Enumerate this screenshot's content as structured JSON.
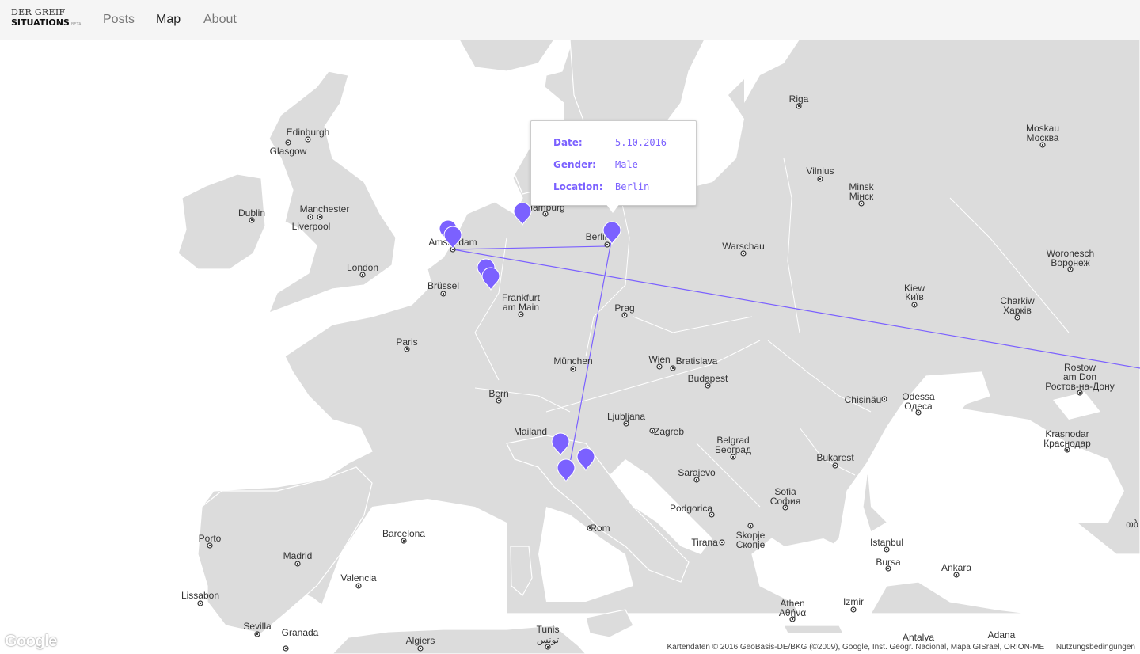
{
  "nav": {
    "logo_top": "DER GREIF",
    "logo_bottom": "SITUATIONS",
    "logo_beta": "BETA",
    "links": [
      "Posts",
      "Map",
      "About"
    ],
    "active": "Map"
  },
  "map": {
    "accent_color": "#7B61FF",
    "land_color": "#dcdcdc",
    "water_color": "#ffffff",
    "cities": [
      "Riga",
      "Edinburgh",
      "Glasgow",
      "Moskau",
      "Москва",
      "Dublin",
      "Manchester",
      "Liverpool",
      "Vilnius",
      "Minsk",
      "Мінск",
      "Hamburg",
      "Amsterdam",
      "Berlin",
      "Warschau",
      "London",
      "Woronesch",
      "Воронеж",
      "Kiew",
      "Київ",
      "Brüssel",
      "Frankfurt",
      "am Main",
      "Charkiw",
      "Харків",
      "Prag",
      "Paris",
      "München",
      "Wien",
      "Bratislava",
      "Rostow",
      "am Don",
      "Ростов-на-Дону",
      "Budapest",
      "Bern",
      "Chișinău",
      "Odessa",
      "Одеса",
      "Ljubljana",
      "Mailand",
      "Zagreb",
      "Krasnodar",
      "Краснодар",
      "Belgrad",
      "Београд",
      "Bukarest",
      "Sarajevo",
      "Sofia",
      "София",
      "Podgorica",
      "Skopje",
      "Скопје",
      "Rom",
      "Tirana",
      "Istanbul",
      "Bursa",
      "Ankara",
      "Barcelona",
      "Porto",
      "Madrid",
      "Valencia",
      "Lissabon",
      "Athen",
      "Αθήνα",
      "Izmir",
      "Sevilla",
      "Granada",
      "Algiers",
      "Tunis",
      "تونس",
      "Antalya",
      "Adana",
      "თბ"
    ],
    "tooltip": {
      "rows": [
        {
          "key": "Date:",
          "value": "5.10.2016"
        },
        {
          "key": "Gender:",
          "value": "Male"
        },
        {
          "key": "Location:",
          "value": "Berlin"
        }
      ]
    },
    "google_label": "Google",
    "attribution": "Kartendaten © 2016 GeoBasis-DE/BKG (©2009), Google, Inst. Geogr. Nacional, Mapa GISrael, ORION-ME",
    "terms": "Nutzungsbedingungen"
  }
}
